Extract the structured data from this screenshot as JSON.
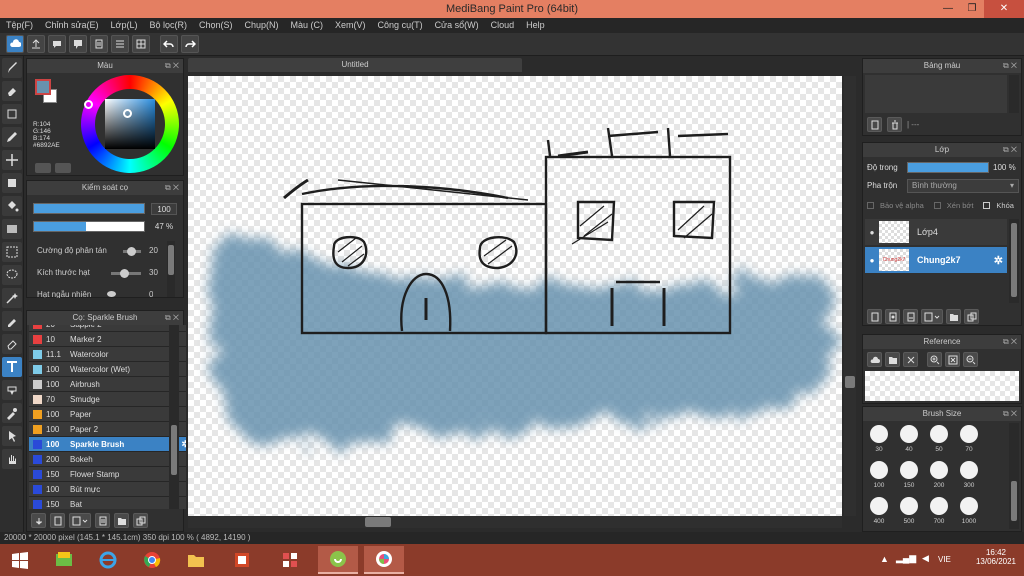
{
  "app": {
    "title": "MediBang Paint Pro (64bit)"
  },
  "window_controls": {
    "minimize": "—",
    "restore": "❐",
    "close": "✕"
  },
  "menu": [
    "Tệp(F)",
    "Chỉnh sửa(E)",
    "Lớp(L)",
    "Bộ lọc(R)",
    "Chọn(S)",
    "Chụp(N)",
    "Màu (C)",
    "Xem(V)",
    "Công cụ(T)",
    "Cửa sổ(W)",
    "Cloud",
    "Help"
  ],
  "panel_buttons": "⧉ ✕",
  "color_panel": {
    "title": "Màu",
    "fg_color": "#6892ae",
    "rgb": {
      "r": "R:104",
      "g": "G:146",
      "b": "B:174",
      "hex": "#6892AE"
    }
  },
  "brush_control": {
    "title": "Kiểm soát cọ",
    "size_value": "100",
    "size_fraction": 1.0,
    "opacity_value": "47 %",
    "opacity_fraction": 0.47,
    "rows": [
      {
        "label": "Cường độ phân tán",
        "value": "20",
        "fraction": 0.2
      },
      {
        "label": "Kích thước hạt",
        "value": "30",
        "fraction": 0.3
      },
      {
        "label": "Hạt ngẫu nhiên",
        "value": "0",
        "fraction": 0.0
      }
    ]
  },
  "brush_panel": {
    "title": "Cọ: Sparkle Brush",
    "items": [
      {
        "size": "20",
        "name": "Sapple 2",
        "color": "#e84040"
      },
      {
        "size": "10",
        "name": "Marker 2",
        "color": "#e84040"
      },
      {
        "size": "11.1",
        "name": "Watercolor",
        "color": "#7ecbe8"
      },
      {
        "size": "100",
        "name": "Watercolor (Wet)",
        "color": "#7ecbe8"
      },
      {
        "size": "100",
        "name": "Airbrush",
        "color": "#cccccc"
      },
      {
        "size": "70",
        "name": "Smudge",
        "color": "#f0d8c8"
      },
      {
        "size": "100",
        "name": "Paper",
        "color": "#f0a020"
      },
      {
        "size": "100",
        "name": "Paper 2",
        "color": "#f0a020"
      },
      {
        "size": "100",
        "name": "Sparkle Brush",
        "color": "#2a4ad8",
        "selected": true
      },
      {
        "size": "200",
        "name": "Bokeh",
        "color": "#2a4ad8"
      },
      {
        "size": "150",
        "name": "Flower Stamp",
        "color": "#2a4ad8"
      },
      {
        "size": "100",
        "name": "Bút mực",
        "color": "#2a4ad8"
      },
      {
        "size": "150",
        "name": "Bat",
        "color": "#2a4ad8"
      }
    ]
  },
  "document": {
    "tab": "Untitled"
  },
  "palette_panel": {
    "title": "Bảng màu",
    "info": "| ---"
  },
  "layer_panel": {
    "title": "Lớp",
    "opacity_label": "Độ trong",
    "opacity_value": "100 %",
    "opacity_fraction": 1.0,
    "blend_label": "Pha trộn",
    "blend_value": "Bình thường",
    "protect_alpha": "Bảo vệ alpha",
    "clipping": "Xén bớt",
    "lock": "Khóa",
    "layers": [
      {
        "name": "Lớp4",
        "selected": false
      },
      {
        "name": "Chung2k7",
        "selected": true,
        "thumb_text": "Chung2k7"
      }
    ]
  },
  "reference_panel": {
    "title": "Reference"
  },
  "brush_size_panel": {
    "title": "Brush Size",
    "sizes": [
      "30",
      "40",
      "50",
      "70",
      "100",
      "150",
      "200",
      "300",
      "400",
      "500",
      "700",
      "1000"
    ]
  },
  "status": {
    "text": "20000 * 20000 pixel  (145.1 * 145.1cm)  350 dpi  100 %  ( 4892, 14190 )"
  },
  "taskbar": {
    "lang": "VIE",
    "time": "16:42",
    "date": "13/06/2021"
  },
  "colors": {
    "accent": "#3b82c4",
    "titlebar": "#e47f62",
    "taskbar": "#8b3b2a",
    "paint": "#6892ae"
  }
}
